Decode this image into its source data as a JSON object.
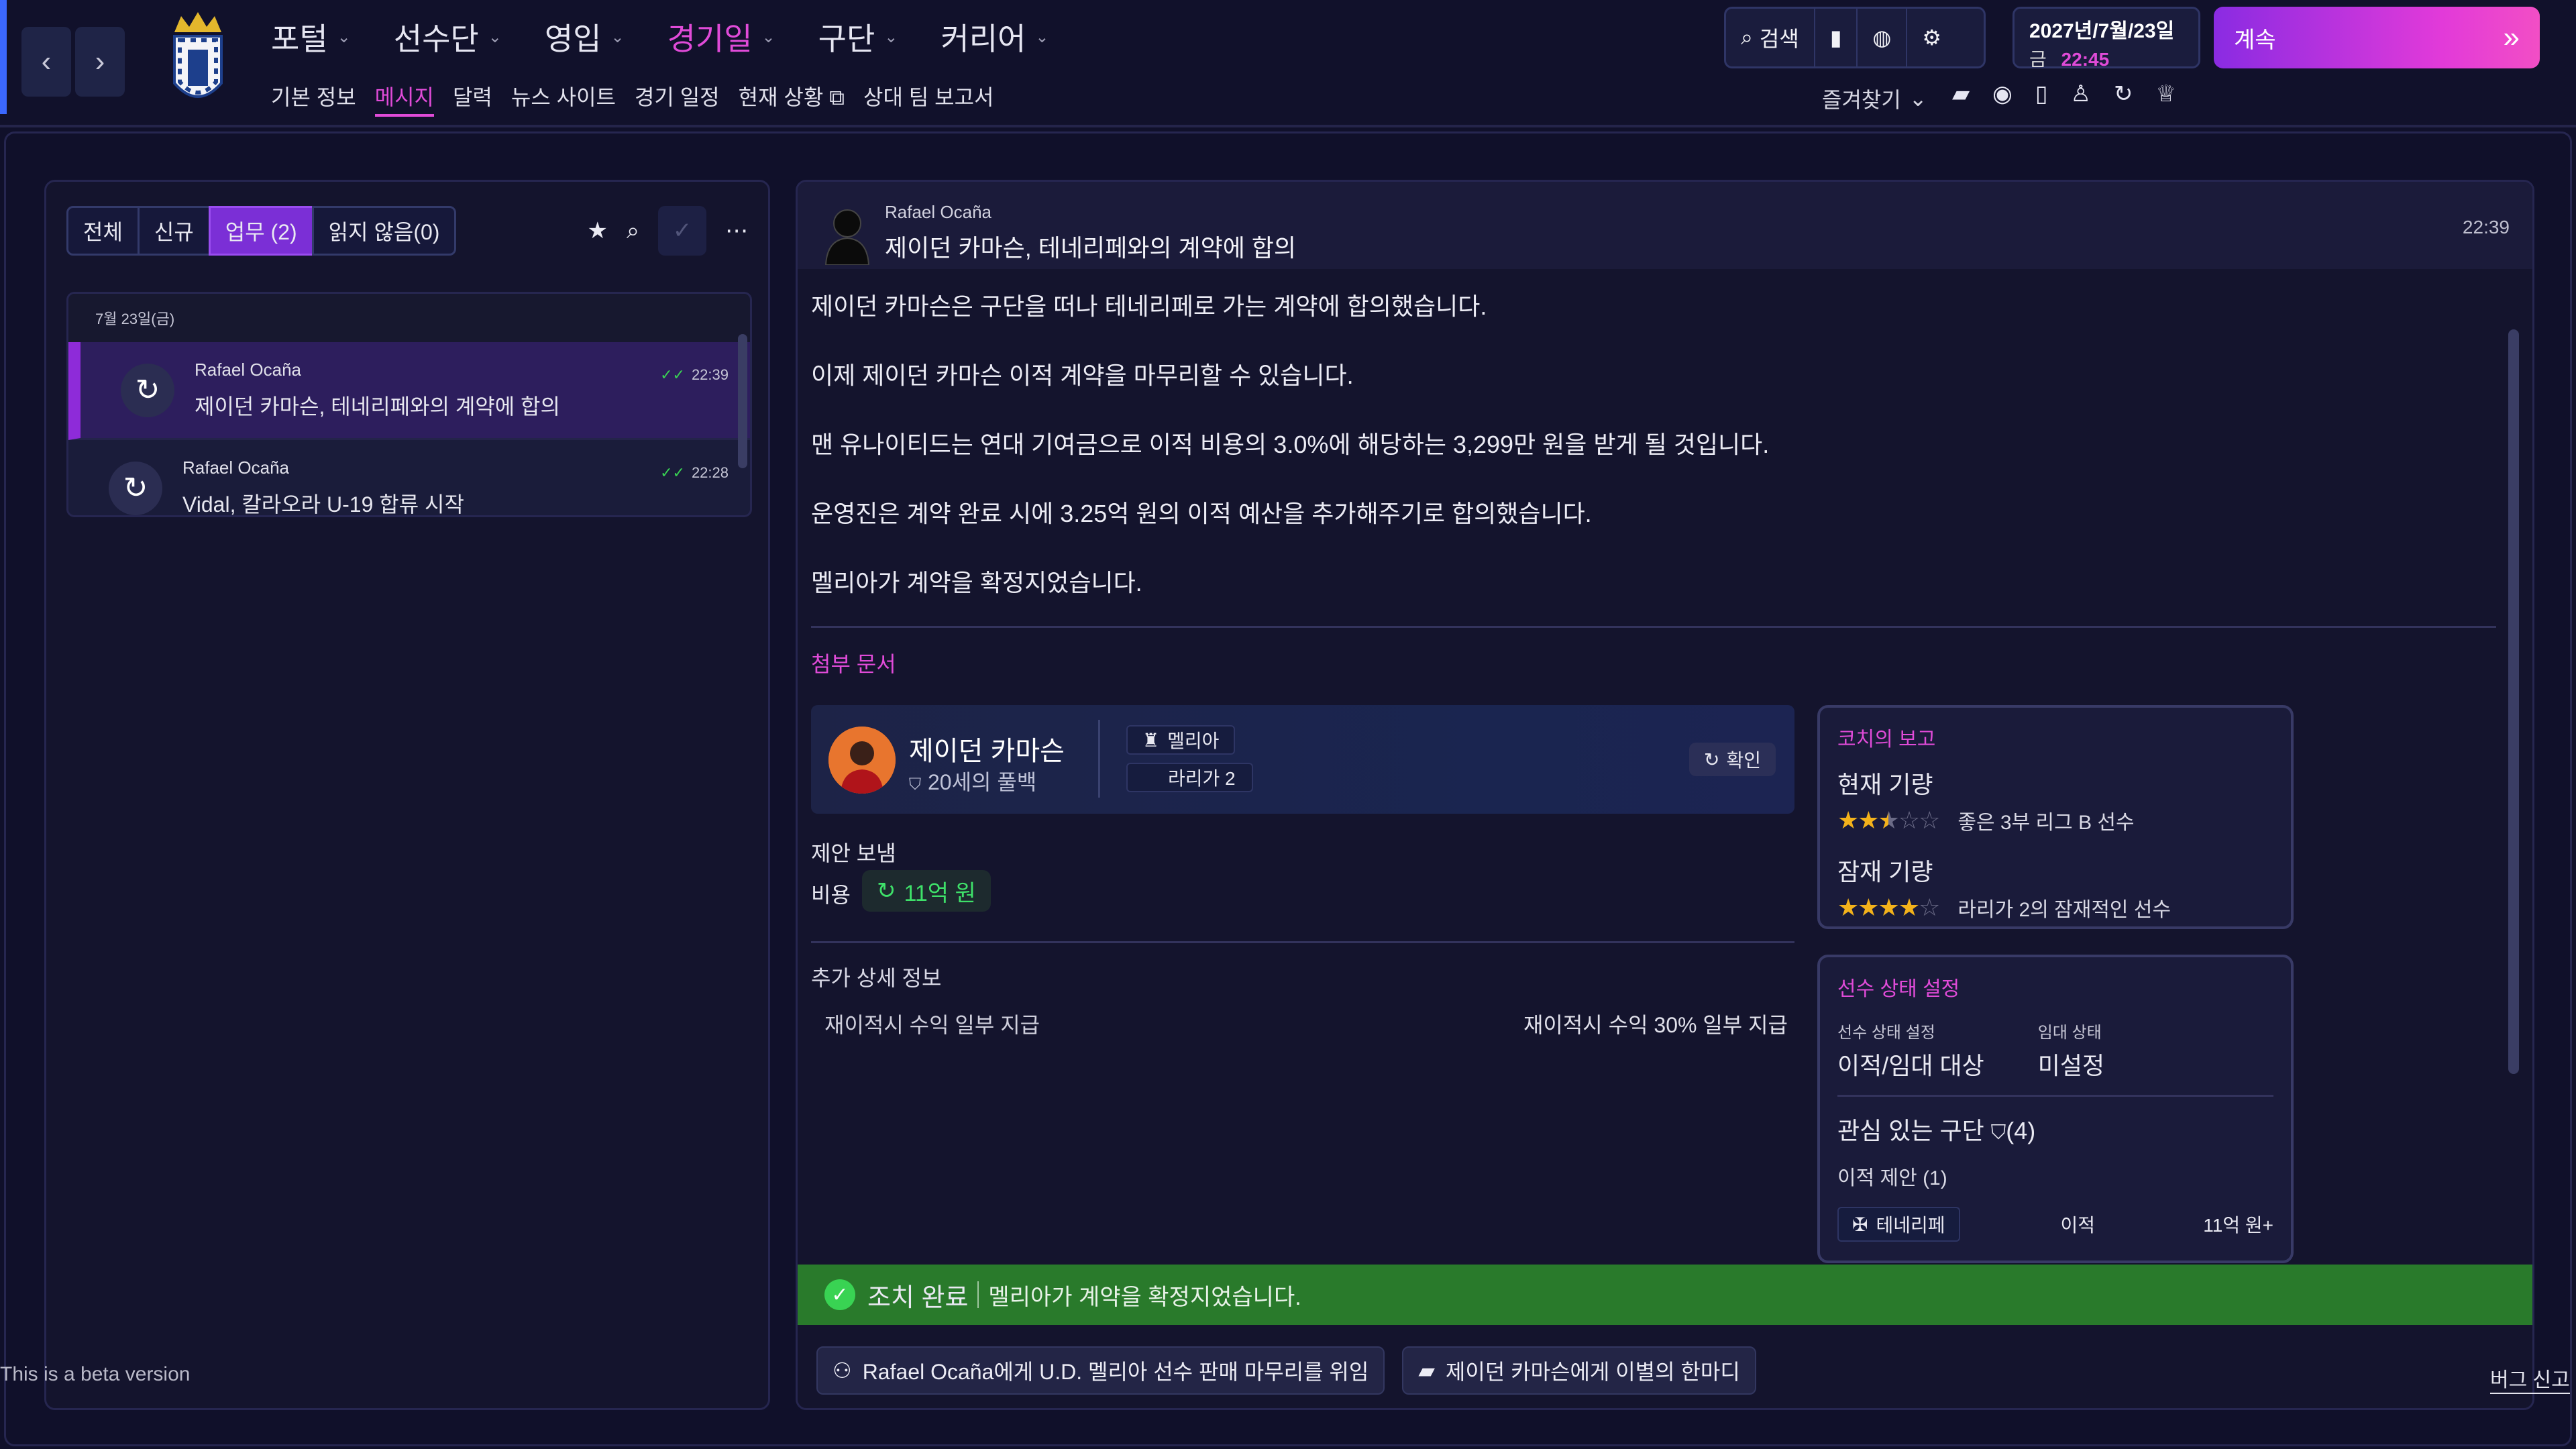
{
  "nav": {
    "back": "‹",
    "forward": "›",
    "menu": [
      {
        "label": "포털",
        "active": false
      },
      {
        "label": "선수단",
        "active": false
      },
      {
        "label": "영입",
        "active": false
      },
      {
        "label": "경기일",
        "active": true
      },
      {
        "label": "구단",
        "active": false
      },
      {
        "label": "커리어",
        "active": false
      }
    ],
    "submenu": [
      "기본 정보",
      "메시지",
      "달력",
      "뉴스 사이트",
      "경기 일정",
      "현재 상황",
      "상대 팀 보고서"
    ],
    "submenu_active": "메시지"
  },
  "toolbar": {
    "search": "검색",
    "search_icon": "magnifier-icon",
    "notes_icon": "note-icon",
    "globe_icon": "globe-icon",
    "settings_icon": "gear-icon"
  },
  "date": {
    "line1": "2027년/7월/23일",
    "day": "금",
    "time": "22:45"
  },
  "continue": {
    "label": "계속",
    "icon": "fast-forward-icon"
  },
  "favorites": {
    "label": "즐겨찾기"
  },
  "left": {
    "tabs": [
      {
        "label": "전체",
        "active": false
      },
      {
        "label": "신규",
        "active": false
      },
      {
        "label": "업무 (2)",
        "active": true
      },
      {
        "label": "읽지 않음(0)",
        "active": false
      }
    ],
    "date_header": "7월 23일(금)",
    "messages": [
      {
        "sender": "Rafael Ocaña",
        "subject": "제이던 카마슨, 테네리페와의 계약에 합의",
        "time": "22:39",
        "selected": true
      },
      {
        "sender": "Rafael Ocaña",
        "subject": "Vidal, 칼라오라 U-19 합류 시작",
        "time": "22:28",
        "selected": false
      }
    ]
  },
  "beta_text": "This is a beta version",
  "bug_report": "버그 신고",
  "message": {
    "sender": "Rafael Ocaña",
    "subject": "제이던 카마슨, 테네리페와의 계약에 합의",
    "time": "22:39",
    "body": [
      "제이던 카마슨은 구단을 떠나 테네리페로 가는 계약에 합의했습니다.",
      "이제 제이던 카마슨 이적 계약을 마무리할 수 있습니다.",
      "맨 유나이티드는 연대 기여금으로 이적 비용의 3.0%에 해당하는 3,299만 원을 받게 될 것입니다.",
      "운영진은 계약 완료 시에 3.25억 원의 이적 예산을 추가해주기로 합의했습니다.",
      "멜리아가 계약을 확정지었습니다."
    ],
    "attachments_title": "첨부 문서"
  },
  "player": {
    "name": "제이던 카마슨",
    "sub": "20세의 풀백",
    "club": "멜리아",
    "league": "라리가 2",
    "confirm": "확인"
  },
  "offer": {
    "label": "제안 보냄",
    "cost_label": "비용",
    "cost_value": "11억 원"
  },
  "extra": {
    "title": "추가 상세 정보",
    "left": "재이적시 수익 일부 지급",
    "right": "재이적시 수익 30% 일부 지급"
  },
  "coach": {
    "title": "코치의 보고",
    "current_label": "현재 기량",
    "current_stars": 2.5,
    "current_text": "좋은 3부 리그 B 선수",
    "potential_label": "잠재 기량",
    "potential_stars": 4,
    "potential_text": "라리가 2의 잠재적인 선수"
  },
  "status": {
    "title": "선수 상태 설정",
    "status_label": "선수 상태 설정",
    "status_value": "이적/임대 대상",
    "loan_label": "임대 상태",
    "loan_value": "미설정",
    "interested_label": "관심 있는 구단",
    "interested_count": "(4)",
    "offers_label": "이적 제안 (1)",
    "offer_club": "테네리페",
    "offer_type": "이적",
    "offer_amount": "11억 원+"
  },
  "action": {
    "done": "조치 완료",
    "text": "멜리아가 계약을 확정지었습니다."
  },
  "buttons": [
    {
      "label": "Rafael Ocaña에게 U.D. 멜리아 선수 판매 마무리를 위임",
      "icon": "delegate-icon"
    },
    {
      "label": "제이던 카마슨에게 이별의 한마디",
      "icon": "chat-icon"
    }
  ],
  "colors": {
    "accent": "#e04bd8",
    "action_green": "#297a2b",
    "continue_gradient_start": "#8a2be2"
  }
}
